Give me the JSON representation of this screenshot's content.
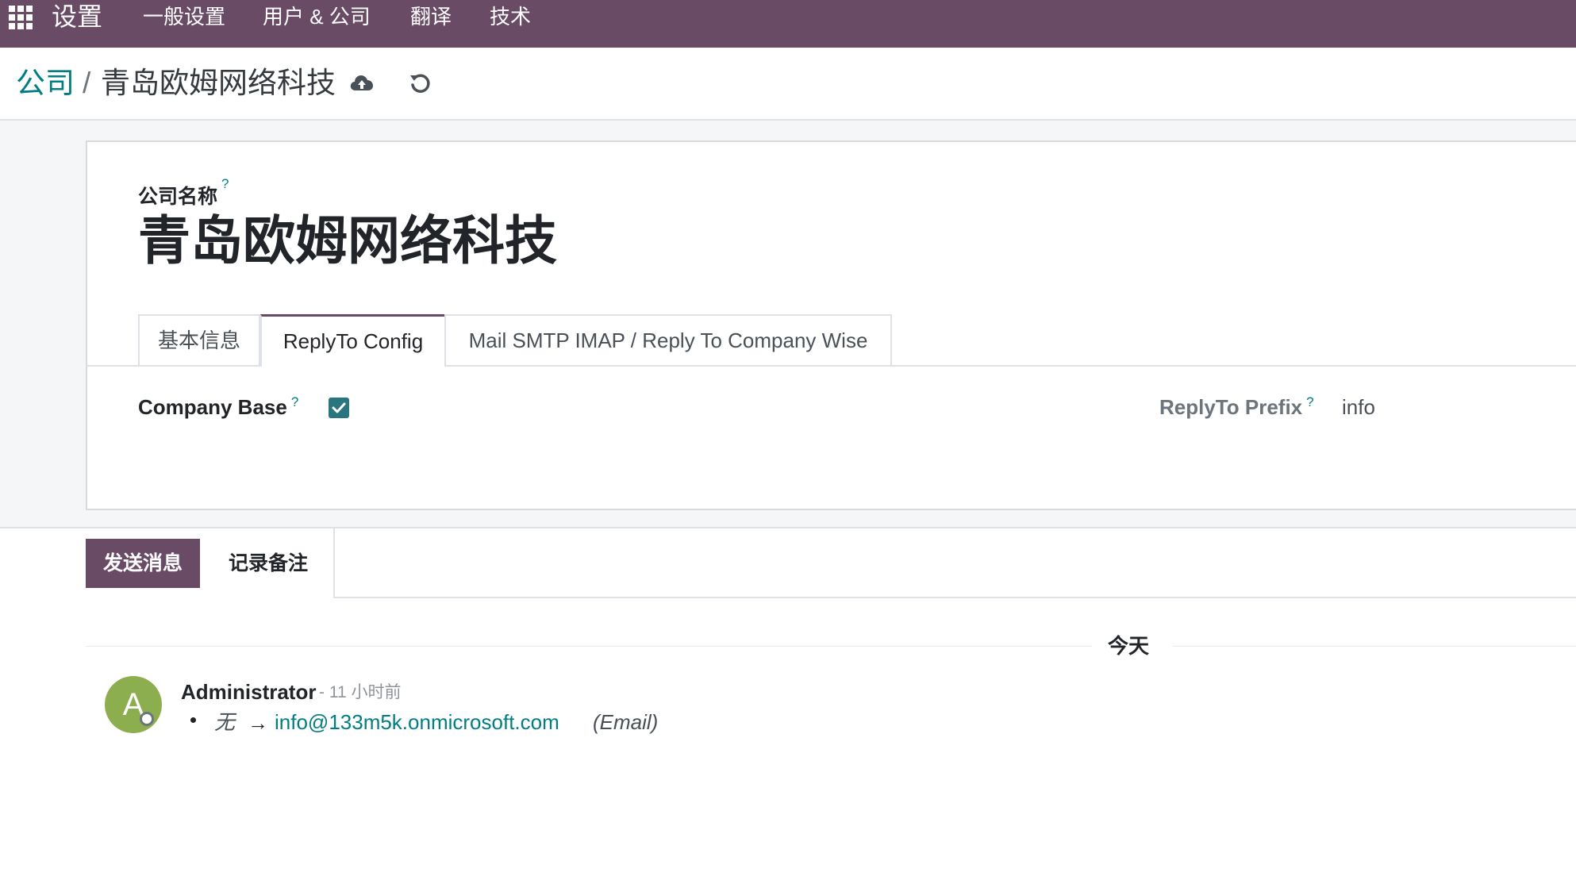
{
  "navbar": {
    "brand": "设置",
    "menu": [
      "一般设置",
      "用户 & 公司",
      "翻译",
      "技术"
    ]
  },
  "breadcrumb": {
    "parent": "公司",
    "separator": "/",
    "current": "青岛欧姆网络科技"
  },
  "form": {
    "company_name_label": "公司名称",
    "help_mark": "?",
    "company_name": "青岛欧姆网络科技",
    "tabs": [
      "基本信息",
      "ReplyTo Config",
      "Mail SMTP IMAP / Reply To Company Wise"
    ],
    "active_tab": "ReplyTo Config",
    "company_base_label": "Company Base",
    "company_base_checked": true,
    "replyto_prefix_label": "ReplyTo Prefix",
    "replyto_prefix_value": "info"
  },
  "chatter": {
    "send_message": "发送消息",
    "log_note": "记录备注",
    "date_separator": "今天",
    "message": {
      "avatar_initial": "A",
      "author": "Administrator",
      "date": "- 11 小时前",
      "old_value": "无",
      "arrow": "→",
      "new_value": "info@133m5k.onmicrosoft.com",
      "field": "(Email)"
    }
  },
  "colors": {
    "navbar": "#6a4b66",
    "accent": "#017e84",
    "checkbox": "#2a7580",
    "avatar": "#8cae4f"
  }
}
